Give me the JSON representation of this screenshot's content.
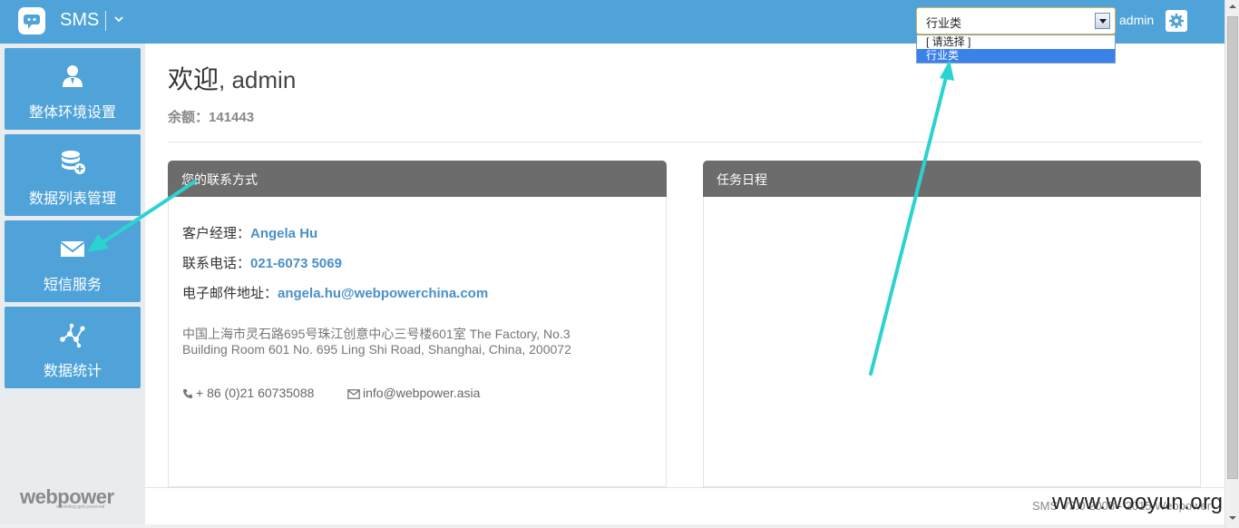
{
  "header": {
    "app_name": "SMS",
    "industry_select": {
      "value": "行业类",
      "options": [
        "[ 请选择 ]",
        "行业类"
      ],
      "selected_index": 1
    },
    "user": "admin"
  },
  "sidebar": {
    "items": [
      {
        "label": "整体环境设置",
        "icon": "user-icon"
      },
      {
        "label": "数据列表管理",
        "icon": "database-icon"
      },
      {
        "label": "短信服务",
        "icon": "envelope-icon"
      },
      {
        "label": "数据统计",
        "icon": "network-icon"
      }
    ],
    "brand": "webpower",
    "brand_tagline": "marketing gets personal"
  },
  "main": {
    "welcome": "欢迎",
    "welcome_user": ", admin",
    "balance_label": "余额：",
    "balance_value": "141443",
    "contact_panel": {
      "title": "您的联系方式",
      "manager_label": "客户经理：",
      "manager_value": "Angela Hu",
      "phone_label": "联系电话：",
      "phone_value": "021-6073 5069",
      "email_label": "电子邮件地址：",
      "email_value": "angela.hu@webpowerchina.com",
      "address_line1": "中国上海市灵石路695号珠江创意中心三号楼601室 The Factory, No.3",
      "address_line2": "Building Room 601 No. 695 Ling Shi Road, Shanghai, China, 200072",
      "office_phone": "+ 86 (0)21 60735088",
      "office_email": "info@webpower.asia"
    },
    "schedule_panel": {
      "title": "任务日程"
    }
  },
  "footer": {
    "text": "SMS V3.0 2008 - 2015 Webpower"
  },
  "watermark": "www.wooyun.org",
  "colors": {
    "header_bg": "#4fa3d9",
    "sidebar_item_bg": "#4fa3d9",
    "panel_head_bg": "#6c6c6c",
    "link": "#4a90c8",
    "annotation_arrow": "#2bd3d0"
  }
}
